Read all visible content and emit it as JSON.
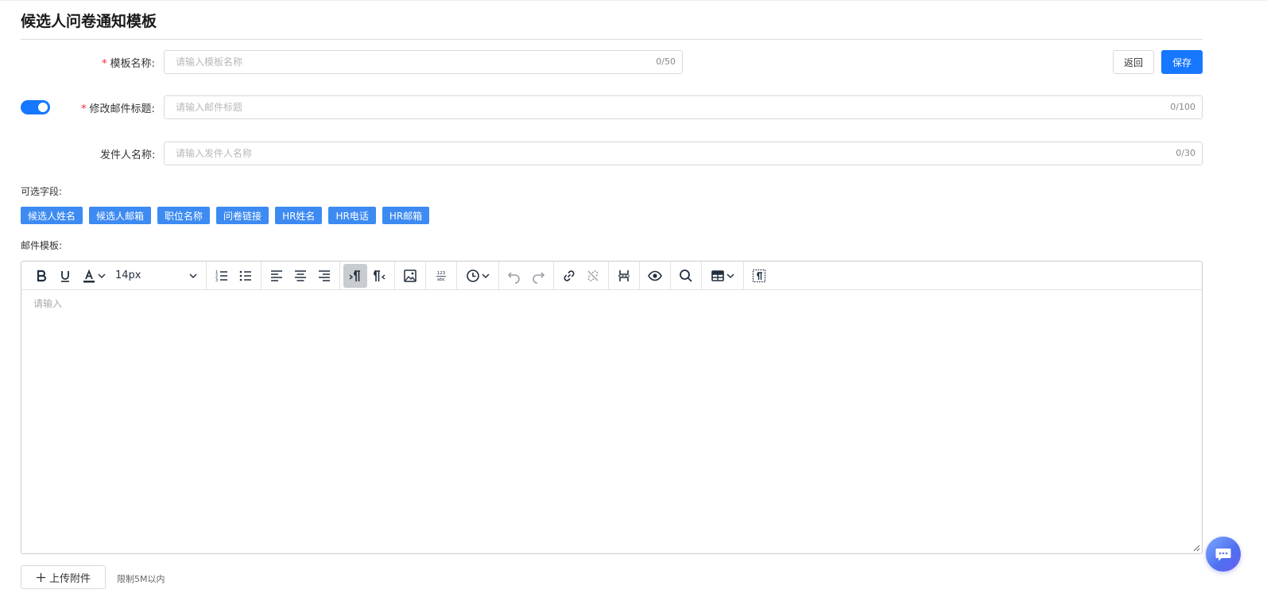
{
  "page": {
    "title": "候选人问卷通知模板"
  },
  "actions": {
    "back_label": "返回",
    "save_label": "保存"
  },
  "form": {
    "template_name": {
      "required_mark": "*",
      "label": "模板名称:",
      "placeholder": "请输入模板名称",
      "value": "",
      "counter": "0/50"
    },
    "mail_subject": {
      "toggle_on": true,
      "required_mark": "*",
      "label": "修改邮件标题:",
      "placeholder": "请输入邮件标题",
      "value": "",
      "counter": "0/100"
    },
    "sender_name": {
      "label": "发件人名称:",
      "placeholder": "请输入发件人名称",
      "value": "",
      "counter": "0/30"
    }
  },
  "fields_section": {
    "label": "可选字段:",
    "tags": [
      "候选人姓名",
      "候选人邮箱",
      "职位名称",
      "问卷链接",
      "HR姓名",
      "HR电话",
      "HR邮箱"
    ]
  },
  "template_section": {
    "label": "邮件模板:"
  },
  "editor": {
    "font_size": "14px",
    "placeholder": "请输入",
    "toolbar_icons": [
      "bold-icon",
      "underline-icon",
      "font-color-icon",
      "numbered-list-icon",
      "bulleted-list-icon",
      "align-left-icon",
      "align-center-icon",
      "align-right-icon",
      "ltr-icon",
      "rtl-icon",
      "image-icon",
      "word-count-icon",
      "clock-icon",
      "undo-icon",
      "redo-icon",
      "link-icon",
      "unlink-icon",
      "page-break-icon",
      "preview-icon",
      "search-icon",
      "table-icon",
      "show-blocks-icon"
    ]
  },
  "upload": {
    "button_label": "上传附件",
    "hint": "限制5M以内"
  },
  "colors": {
    "primary": "#1677ff",
    "tag": "#3d8bf2",
    "required": "#f5222d"
  }
}
